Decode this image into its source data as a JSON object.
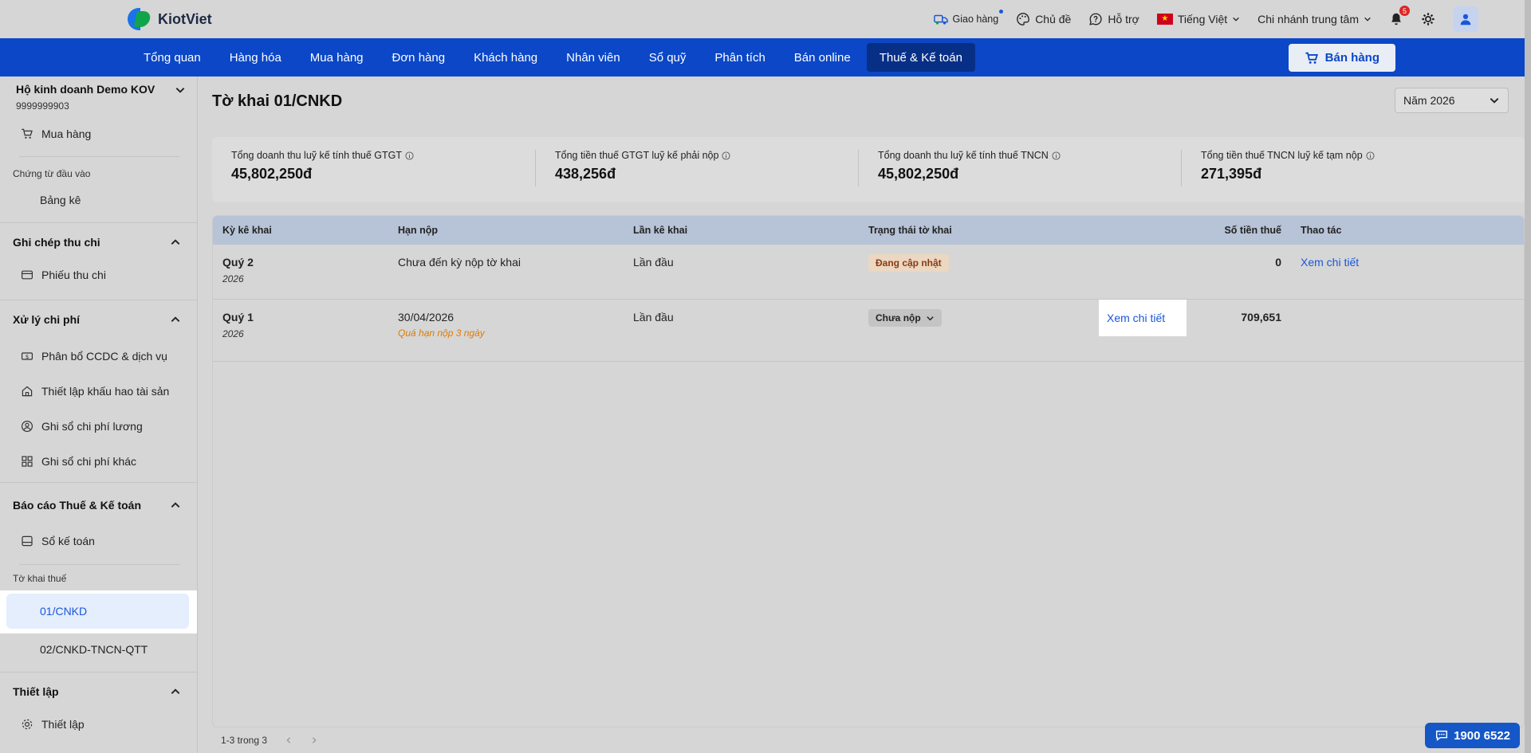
{
  "header": {
    "logo_text": "KiotViet",
    "delivery": "Giao hàng",
    "theme": "Chủ đề",
    "support": "Hỗ trợ",
    "language": "Tiếng Việt",
    "branch": "Chi nhánh trung tâm",
    "notifications": "5"
  },
  "nav": {
    "items": [
      "Tổng quan",
      "Hàng hóa",
      "Mua hàng",
      "Đơn hàng",
      "Khách hàng",
      "Nhân viên",
      "Sổ quỹ",
      "Phân tích",
      "Bán online",
      "Thuế & Kế toán"
    ],
    "active_index": 9,
    "sell_button": "Bán hàng"
  },
  "sidebar": {
    "business_name": "Hộ kinh doanh Demo KOV",
    "business_id": "9999999903",
    "purchase": "Mua hàng",
    "input_docs_label": "Chứng từ đầu vào",
    "statement": "Bảng kê",
    "cash_group": "Ghi chép thu chi",
    "receipts": "Phiếu thu chi",
    "expense_group": "Xử lý chi phí",
    "allocation": "Phân bổ CCDC & dịch vụ",
    "depreciation": "Thiết lập khấu hao tài sản",
    "salary": "Ghi sổ chi phí lương",
    "other_expense": "Ghi sổ chi phí khác",
    "report_group": "Báo cáo Thuế & Kế toán",
    "ledger": "Sổ kế toán",
    "tax_forms_label": "Tờ khai thuế",
    "form1": "01/CNKD",
    "form2": "02/CNKD-TNCN-QTT",
    "settings_group": "Thiết lập",
    "settings": "Thiết lập"
  },
  "page": {
    "title": "Tờ khai 01/CNKD",
    "year": "Năm 2026"
  },
  "summary": [
    {
      "label": "Tổng doanh thu luỹ kế tính thuế GTGT",
      "value": "45,802,250đ"
    },
    {
      "label": "Tổng tiền thuế GTGT luỹ kế phải nộp",
      "value": "438,256đ"
    },
    {
      "label": "Tổng doanh thu luỹ kế tính thuế TNCN",
      "value": "45,802,250đ"
    },
    {
      "label": "Tổng tiền thuế TNCN luỹ kế tạm nộp",
      "value": "271,395đ"
    }
  ],
  "table": {
    "headers": {
      "period": "Kỳ kê khai",
      "deadline": "Hạn nộp",
      "times": "Lần kê khai",
      "status": "Trạng thái tờ khai",
      "amount": "Số tiền thuế",
      "actions": "Thao tác"
    },
    "rows": [
      {
        "period": "Quý 2",
        "year": "2026",
        "deadline": "Chưa đến kỳ nộp tờ khai",
        "deadline_note": "",
        "times": "Lần đầu",
        "status": "Đang cập nhật",
        "amount": "0",
        "action": "Xem chi tiết"
      },
      {
        "period": "Quý 1",
        "year": "2026",
        "deadline": "30/04/2026",
        "deadline_note": "Quá hạn nộp 3 ngày",
        "times": "Lần đầu",
        "status": "Chưa nộp",
        "amount": "709,651",
        "action": "Xem chi tiết"
      }
    ]
  },
  "pager": {
    "text": "1-3 trong 3"
  },
  "hotline": "1900 6522",
  "colors": {
    "brand": "#0b47c7",
    "link": "#1a56db",
    "overdue": "#e07b00"
  }
}
